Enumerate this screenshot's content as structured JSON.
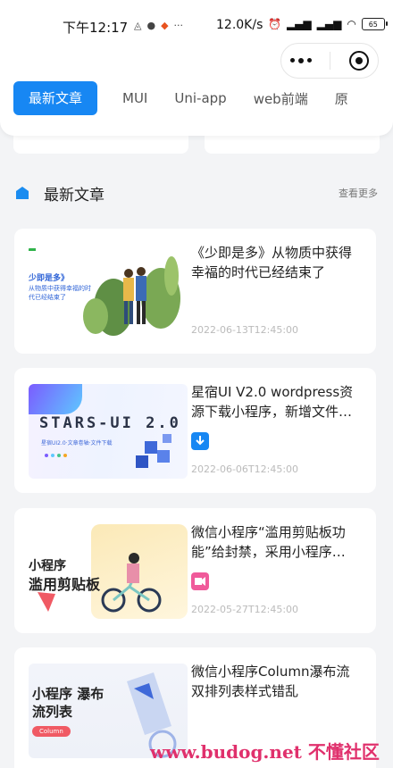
{
  "status_bar": {
    "time": "下午12:17",
    "network_speed": "12.0K/s",
    "battery": "65"
  },
  "tabs": [
    {
      "label": "最新文章",
      "active": true
    },
    {
      "label": "MUI",
      "active": false
    },
    {
      "label": "Uni-app",
      "active": false
    },
    {
      "label": "web前端",
      "active": false
    },
    {
      "label": "原",
      "active": false
    }
  ],
  "section": {
    "title": "最新文章",
    "more": "查看更多"
  },
  "articles": [
    {
      "title": "《少即是多》从物质中获得幸福的时代已经结束了",
      "date": "2022-06-13T12:45:00",
      "thumb_text": "少即是多》",
      "thumb_sub": "从物质中获得幸福的时代已经结束了"
    },
    {
      "title": "星宿UI V2.0 wordpress资源下载小程序，新增文件下…",
      "date": "2022-06-06T12:45:00",
      "thumb_text": "STARS-UI 2.0",
      "thumb_sub": "星宿UI2.0·文章卷轴·文件下载"
    },
    {
      "title": "微信小程序“滥用剪贴板功能”给封禁，采用小程序…",
      "date": "2022-05-27T12:45:00",
      "thumb_text": "小程序",
      "thumb_sub": "滥用剪贴板"
    },
    {
      "title": "微信小程序Column瀑布流双排列表样式错乱",
      "date": "",
      "thumb_text": "小程序 瀑布流列表",
      "thumb_sub": "Column"
    }
  ],
  "watermark": "www.budog.net 不懂社区",
  "colors": {
    "accent": "#1787f3",
    "card_bg": "#ffffff",
    "page_bg": "#f3f4f6"
  }
}
